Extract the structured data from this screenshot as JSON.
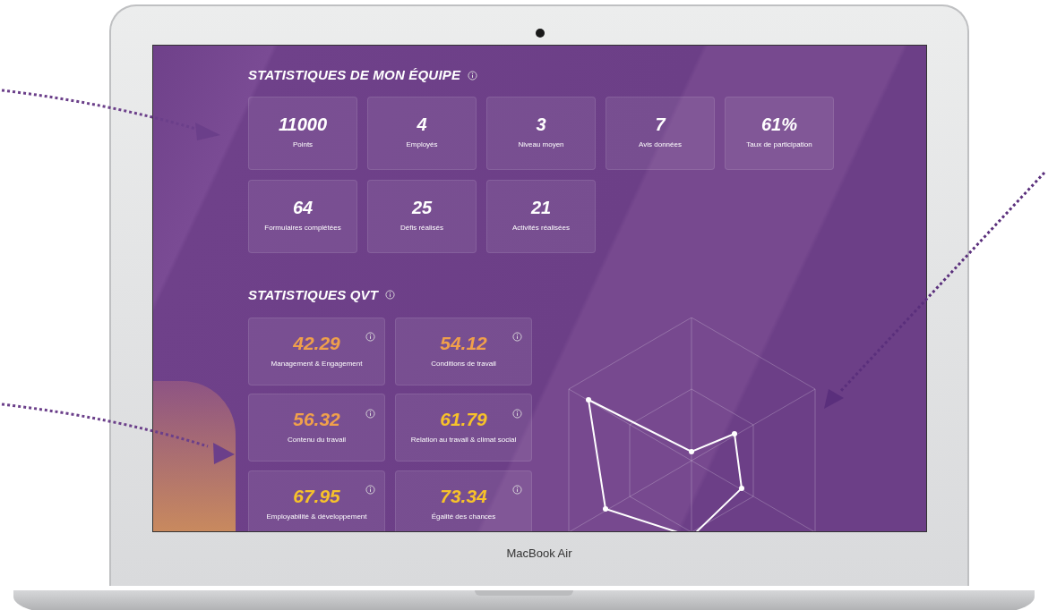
{
  "sections": [
    {
      "title": "STATISTIQUES DE MON ÉQUIPE",
      "kind": "team",
      "cards": [
        {
          "value": "11000",
          "label": "Points"
        },
        {
          "value": "4",
          "label": "Employés"
        },
        {
          "value": "3",
          "label": "Niveau moyen"
        },
        {
          "value": "7",
          "label": "Avis données"
        },
        {
          "value": "61%",
          "label": "Taux de participation"
        },
        {
          "value": "64",
          "label": "Formulaires complétées"
        },
        {
          "value": "25",
          "label": "Défis réalisés"
        },
        {
          "value": "21",
          "label": "Activités réalisées"
        }
      ]
    },
    {
      "title": "STATISTIQUES QVT",
      "kind": "qvt",
      "cards": [
        {
          "value": "42.29",
          "label": "Management & Engagement",
          "color": "#f0a04b"
        },
        {
          "value": "54.12",
          "label": "Conditions de travail",
          "color": "#f0a04b"
        },
        {
          "value": "56.32",
          "label": "Contenu du travail",
          "color": "#f0a04b"
        },
        {
          "value": "61.79",
          "label": "Relation au travail & climat social",
          "color": "#f7c22a"
        },
        {
          "value": "67.95",
          "label": "Employabilité & développement",
          "color": "#f7c22a"
        },
        {
          "value": "73.34",
          "label": "Égalité des chances",
          "color": "#f7c22a"
        }
      ]
    }
  ],
  "device_label": "MacBook Air"
}
